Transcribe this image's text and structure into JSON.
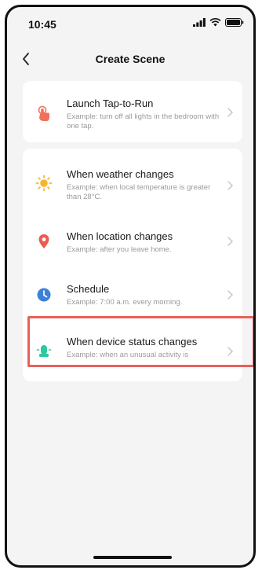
{
  "status": {
    "time": "10:45"
  },
  "nav": {
    "title": "Create Scene"
  },
  "options": {
    "tap_to_run": {
      "title": "Launch Tap-to-Run",
      "desc": "Example: turn off all lights in the bedroom with one tap."
    },
    "weather": {
      "title": "When weather changes",
      "desc": "Example: when local temperature is greater than 28°C."
    },
    "location": {
      "title": "When location changes",
      "desc": "Example: after you leave home."
    },
    "schedule": {
      "title": "Schedule",
      "desc": "Example: 7:00 a.m. every morning."
    },
    "device_status": {
      "title": "When device status changes",
      "desc": "Example: when an unusual activity is detected."
    }
  },
  "icons": {
    "tap": "hand-tap-icon",
    "weather": "sun-icon",
    "location": "location-pin-icon",
    "schedule": "clock-icon",
    "device": "device-status-icon"
  },
  "colors": {
    "tap": "#f0705a",
    "weather": "#f7b52c",
    "location": "#ee5a52",
    "schedule": "#3b82d9",
    "device": "#2fc7a0",
    "highlight": "#e8605a"
  }
}
